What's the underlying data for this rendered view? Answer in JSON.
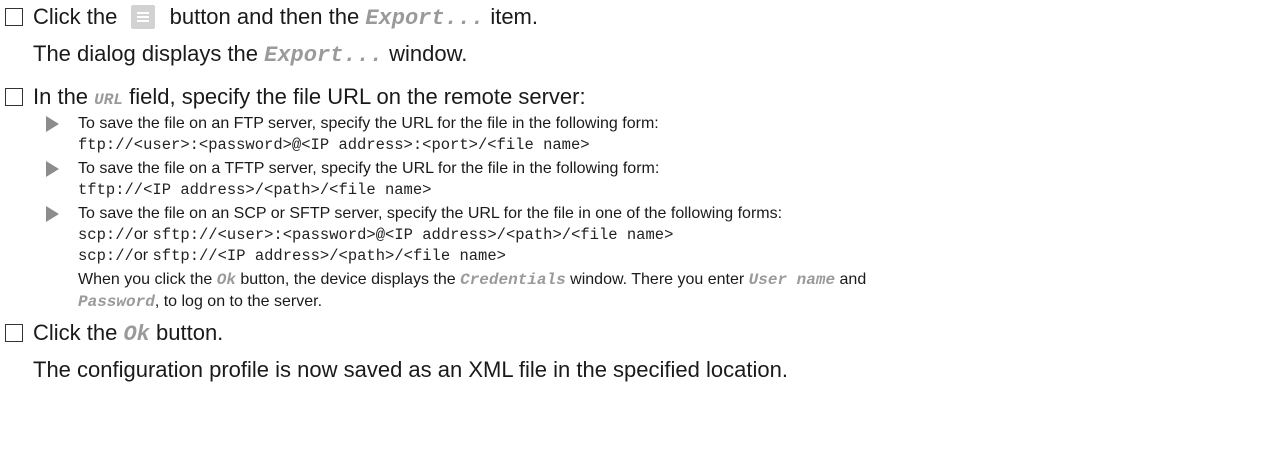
{
  "steps": [
    {
      "before": "Click the",
      "middle": "button and then the",
      "item": "Export...",
      "after": "item.",
      "result_before": "The dialog displays the",
      "result_item": "Export...",
      "result_after": "window."
    },
    {
      "before": "In the",
      "field": "URL",
      "after": "field, specify the file URL on the remote server:",
      "bullets": [
        {
          "text": "To save the file on an FTP server, specify the URL for the file in the following form:",
          "code": "ftp://<user>:<password>@<IP address>:<port>/<file name>"
        },
        {
          "text": "To save the file on a TFTP server, specify the URL for the file in the following form:",
          "code": "tftp://<IP address>/<path>/<file name>"
        },
        {
          "text": "To save the file on an SCP or SFTP server, specify the URL for the file in one of the following forms:",
          "code1a": "scp://",
          "or1": "or",
          "code1b": "sftp://<user>:<password>@<IP address>/<path>/<file name>",
          "code2a": "scp://",
          "or2": "or",
          "code2b": "sftp://<IP address>/<path>/<file name>",
          "note1": "When you click the",
          "note_ok": "Ok",
          "note2": "button, the device displays the",
          "note_cred": "Credentials",
          "note3": "window. There you enter",
          "note_user": "User name",
          "note4": "and",
          "note_pass": "Password",
          "note5": ", to log on to the server."
        }
      ]
    },
    {
      "before": "Click the",
      "button": "Ok",
      "after": "button.",
      "result": "The configuration profile is now saved as an XML file in the specified location."
    }
  ],
  "icons": {
    "menu": "menu-hamburger-icon",
    "checkbox": "checkbox-icon",
    "bullet": "triangle-bullet-icon"
  }
}
